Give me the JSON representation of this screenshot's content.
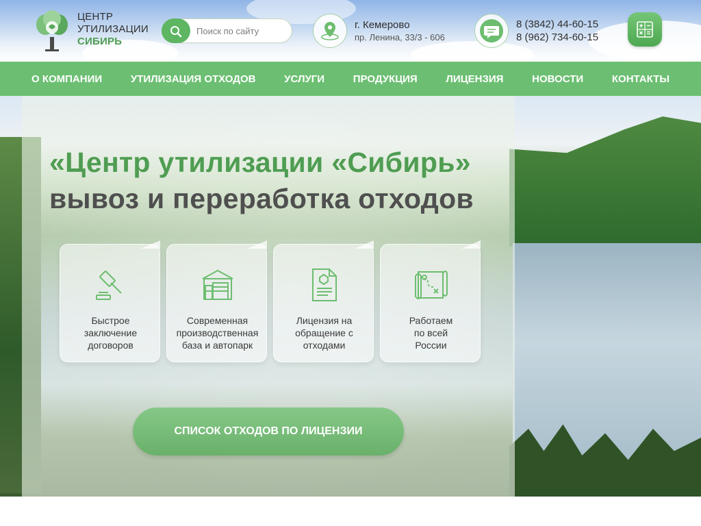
{
  "logo": {
    "line1": "ЦЕНТР",
    "line2": "УТИЛИЗАЦИИ",
    "line3": "СИБИРЬ"
  },
  "search": {
    "placeholder": "Поиск по сайту",
    "icon": "search-icon"
  },
  "address": {
    "city": "г. Кемерово",
    "street": "пр. Ленина, 33/3 - 606",
    "icon": "location-pin-icon"
  },
  "contacts": {
    "phone1": "8 (3842) 44-60-15",
    "phone2": "8 (962) 734-60-15",
    "icon": "chat-icon"
  },
  "calculator": {
    "icon": "calculator-icon"
  },
  "nav": {
    "items": [
      {
        "label": "О КОМПАНИИ"
      },
      {
        "label": "УТИЛИЗАЦИЯ ОТХОДОВ"
      },
      {
        "label": "УСЛУГИ"
      },
      {
        "label": "ПРОДУКЦИЯ"
      },
      {
        "label": "ЛИЦЕНЗИЯ"
      },
      {
        "label": "НОВОСТИ"
      },
      {
        "label": "КОНТАКТЫ"
      }
    ]
  },
  "hero": {
    "title_line1": "«Центр утилизации «Сибирь»",
    "title_line2": "вывоз и переработка отходов",
    "features": [
      {
        "line1": "Быстрое",
        "line2": "заключение",
        "line3": "договоров",
        "icon": "gavel-icon"
      },
      {
        "line1": "Современная",
        "line2": "производственная",
        "line3": "база и автопарк",
        "icon": "warehouse-icon"
      },
      {
        "line1": "Лицензия на",
        "line2": "обращение с",
        "line3": "отходами",
        "icon": "license-document-icon"
      },
      {
        "line1": "Работаем",
        "line2": "по всей",
        "line3": "России",
        "icon": "map-icon"
      }
    ],
    "cta_label": "СПИСОК ОТХОДОВ ПО ЛИЦЕНЗИИ"
  },
  "colors": {
    "brand_green": "#5eb562",
    "nav_green": "#6cbf72",
    "title_green": "#4f9d52",
    "title_gray": "#4f4f4f"
  }
}
